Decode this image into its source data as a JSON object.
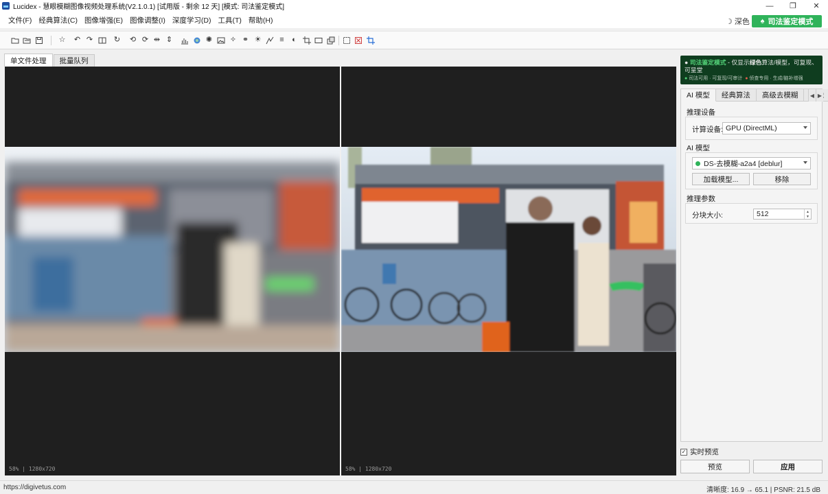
{
  "window": {
    "title": "Lucidex - 慧眼模糊图像视频处理系统(V2.1.0.1) [试用版 - 剩余 12 天] [模式: 司法鉴定模式]",
    "minimize": "—",
    "maximize": "❐",
    "close": "✕"
  },
  "menu": [
    "文件(F)",
    "经典算法(C)",
    "图像增强(E)",
    "图像调整(I)",
    "深度学习(D)",
    "工具(T)",
    "帮助(H)"
  ],
  "theme": {
    "icon": "☽",
    "label": "深色"
  },
  "forensic_button": {
    "icon": "♠",
    "label": "司法鉴定模式"
  },
  "toolbar_icons": [
    "open-file-icon",
    "open-folder-icon",
    "save-icon",
    "star-icon",
    "undo-icon",
    "redo-icon",
    "compare-icon",
    "refresh-icon",
    "rotate-left-icon",
    "rotate-right-icon",
    "flip-horizontal-icon",
    "flip-vertical-icon",
    "histogram-icon",
    "deblur-icon",
    "image-icon",
    "sharpen-icon",
    "effects-icon",
    "brightness-icon",
    "sun-icon",
    "curves-icon",
    "levels-icon",
    "contrast-icon",
    "crop-icon",
    "rectangle-icon",
    "layers-icon",
    "select-icon",
    "clear-selection-icon",
    "crop-active-icon"
  ],
  "tabs": [
    "单文件处理",
    "批量队列"
  ],
  "viewers": [
    {
      "zoom": "58%",
      "size": "1280x720"
    },
    {
      "zoom": "58%",
      "size": "1280x720"
    }
  ],
  "banner": {
    "mode_label": "司法鉴定模式",
    "desc_prefix": " - 仅显示",
    "desc_em": "绿色",
    "desc_suffix": "算法/模型，可复现、可呈堂",
    "legend_green": "司法可用 · 可复现/可审计",
    "legend_red": "侦查专用 · 生成/脑补增强"
  },
  "panel_tabs": [
    "AI 模型",
    "经典算法",
    "高级去模糊",
    "图像"
  ],
  "panel": {
    "device_section": "推理设备",
    "device_label": "计算设备:",
    "device_value": "GPU (DirectML)",
    "model_section": "AI 模型",
    "model_value": "DS-去模糊-a2a4 [deblur]",
    "load_model": "加载模型...",
    "remove": "移除",
    "params_section": "推理参数",
    "tile_label": "分块大小:",
    "tile_value": "512"
  },
  "live_preview": {
    "label": "实时预览",
    "checked": true
  },
  "buttons": {
    "preview": "预览",
    "apply": "应用"
  },
  "status": {
    "url": "https://digivetus.com",
    "metrics": "清晰度: 16.9 → 65.1  |  PSNR: 21.5 dB"
  }
}
